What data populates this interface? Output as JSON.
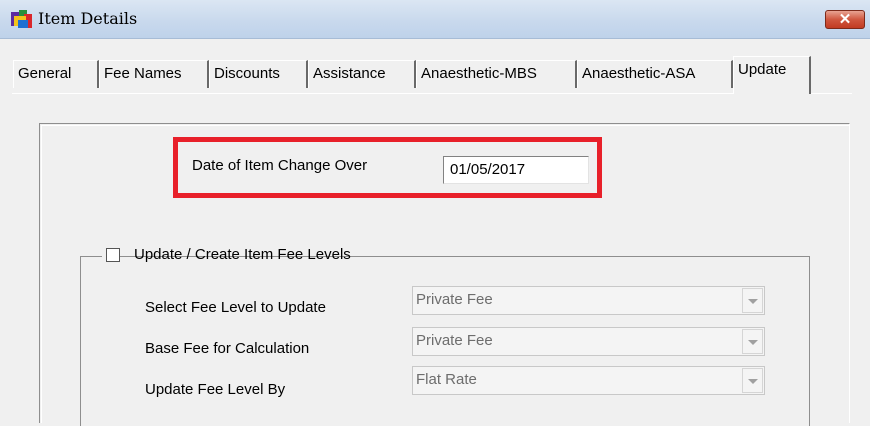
{
  "window": {
    "title": "Item Details",
    "close_label": "✕"
  },
  "tabs": [
    {
      "label": "General"
    },
    {
      "label": "Fee Names"
    },
    {
      "label": "Discounts"
    },
    {
      "label": "Assistance"
    },
    {
      "label": "Anaesthetic-MBS"
    },
    {
      "label": "Anaesthetic-ASA"
    },
    {
      "label": "Update",
      "active": true
    }
  ],
  "changeover": {
    "label": "Date of Item Change Over",
    "value": "01/05/2017",
    "highlight_color": "#e8202a"
  },
  "fee_levels": {
    "checkbox_label": "Update / Create Item Fee Levels",
    "checked": false,
    "rows": [
      {
        "label": "Select Fee Level to Update",
        "value": "Private Fee"
      },
      {
        "label": "Base Fee for Calculation",
        "value": "Private Fee"
      },
      {
        "label": "Update Fee Level By",
        "value": "Flat Rate"
      }
    ]
  }
}
